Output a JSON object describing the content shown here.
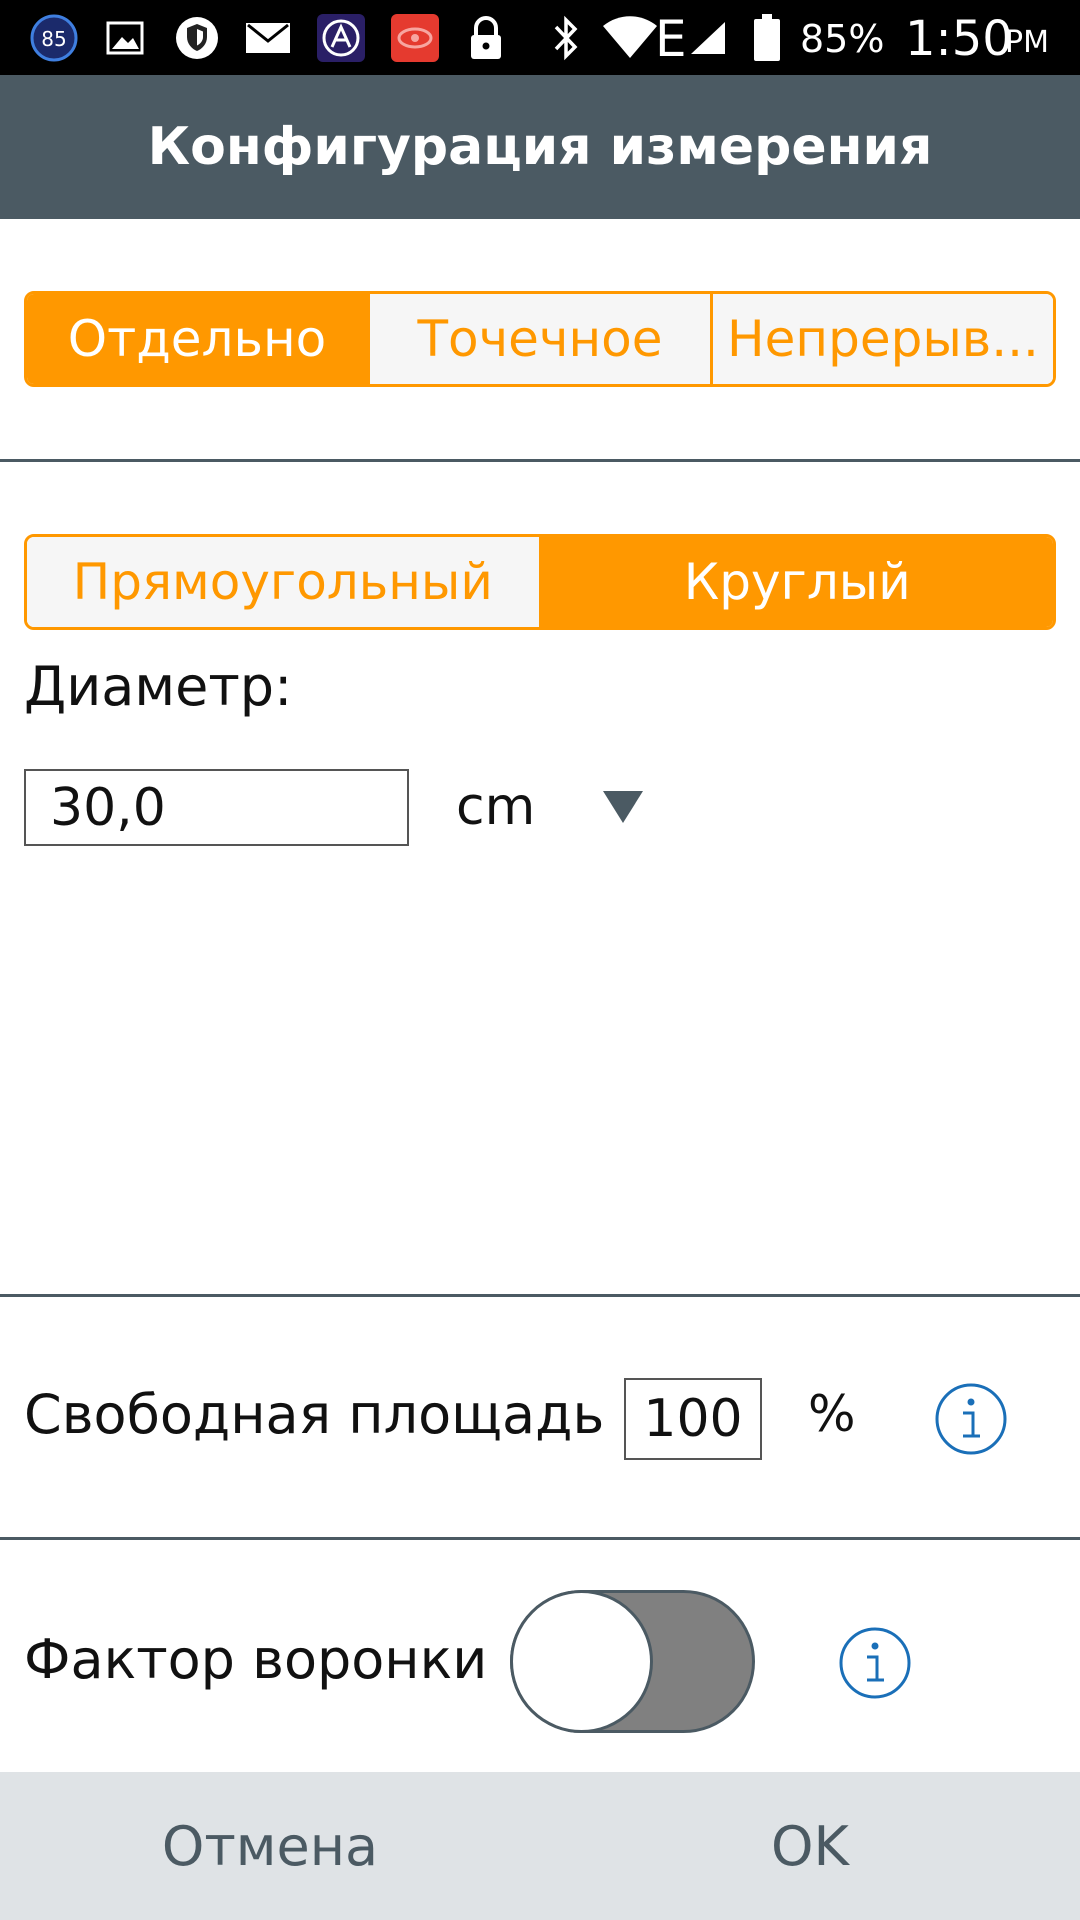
{
  "status_bar": {
    "notification_badge": "85",
    "battery_percent": "85%",
    "time": "1:50",
    "time_suffix": "PM",
    "network_type": "E"
  },
  "header": {
    "title": "Конфигурация измерения"
  },
  "mode_tabs": [
    {
      "label": "Отдельно",
      "active": true
    },
    {
      "label": "Точечное",
      "active": false
    },
    {
      "label": "Непрерыв...",
      "active": false
    }
  ],
  "shape_tabs": [
    {
      "label": "Прямоугольный",
      "active": false
    },
    {
      "label": "Круглый",
      "active": true
    }
  ],
  "diameter": {
    "label": "Диаметр:",
    "value": "30,0",
    "unit": "cm"
  },
  "free_area": {
    "label": "Свободная площадь",
    "value": "100",
    "unit": "%"
  },
  "funnel_factor": {
    "label": "Фактор воронки",
    "enabled": false
  },
  "footer": {
    "cancel_label": "Отмена",
    "ok_label": "OK"
  },
  "colors": {
    "accent": "#ff9800",
    "header_bg": "#4b5a63",
    "info_blue": "#1a6fb8",
    "footer_bg": "#dfe3e6"
  }
}
